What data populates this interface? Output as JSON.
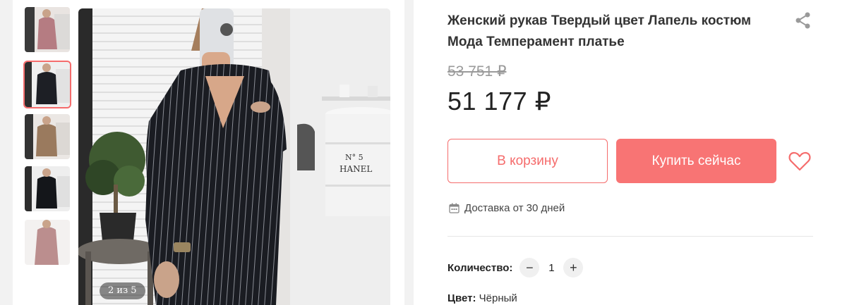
{
  "product": {
    "title": "Женский рукав Твердый цвет Лапель костюм Мода Темперамент платье",
    "old_price": "53 751 ₽",
    "price": "51 177 ₽"
  },
  "gallery": {
    "counter": "2 из 5",
    "thumbnails": [
      {
        "name": "pink dress"
      },
      {
        "name": "black pinstripe dress"
      },
      {
        "name": "khaki dress"
      },
      {
        "name": "black dress"
      },
      {
        "name": "pink dress front"
      }
    ],
    "active_index": 1
  },
  "actions": {
    "add_to_cart": "В корзину",
    "buy_now": "Купить сейчас"
  },
  "delivery": {
    "text": "Доставка от 30 дней"
  },
  "quantity": {
    "label": "Количество:",
    "minus": "−",
    "value": "1",
    "plus": "+"
  },
  "color": {
    "label": "Цвет:",
    "value": "Чёрный"
  },
  "icons": {
    "share": "share-icon",
    "favorite": "heart-icon",
    "delivery": "calendar-icon"
  },
  "colors": {
    "accent": "#f87474",
    "accent_border": "#f56c6c",
    "muted": "#9a9a9a"
  }
}
